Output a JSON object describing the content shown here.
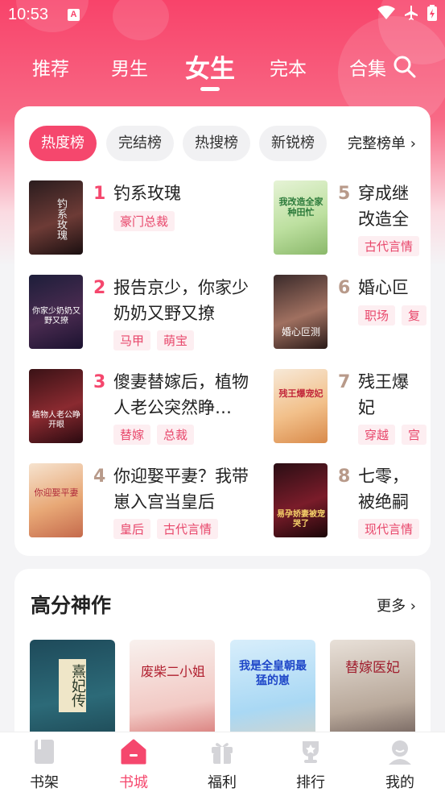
{
  "status_bar": {
    "time": "10:53",
    "badge": "A"
  },
  "top_tabs": [
    {
      "label": "推荐"
    },
    {
      "label": "男生"
    },
    {
      "label": "女生",
      "active": true
    },
    {
      "label": "完本"
    },
    {
      "label": "合集"
    }
  ],
  "rank": {
    "chips": [
      {
        "label": "热度榜",
        "active": true
      },
      {
        "label": "完结榜"
      },
      {
        "label": "热搜榜"
      },
      {
        "label": "新锐榜"
      }
    ],
    "full_list_label": "完整榜单",
    "items": [
      {
        "num": "1",
        "title": "钓系玫瑰",
        "tags": [
          "豪门总裁"
        ]
      },
      {
        "num": "2",
        "title": "报告京少，你家少奶奶又野又撩",
        "tags": [
          "马甲",
          "萌宝"
        ]
      },
      {
        "num": "3",
        "title": "傻妻替嫁后，植物人老公突然睁…",
        "tags": [
          "替嫁",
          "总裁"
        ]
      },
      {
        "num": "4",
        "title": "你迎娶平妻？我带崽入宫当皇后",
        "tags": [
          "皇后",
          "古代言情"
        ]
      },
      {
        "num": "5",
        "title": "穿成继改造全",
        "tags": [
          "古代言情"
        ]
      },
      {
        "num": "6",
        "title": "婚心叵",
        "tags": [
          "职场",
          "复"
        ]
      },
      {
        "num": "7",
        "title": "残王爆妃",
        "tags": [
          "穿越",
          "宫"
        ]
      },
      {
        "num": "8",
        "title": "七零，被绝嗣",
        "tags": [
          "现代言情"
        ]
      }
    ],
    "cover_texts": [
      "钓系玫瑰",
      "你家少奶奶又野又撩",
      "植物人老公睁开眼",
      "你迎娶平妻",
      "我改造全家种田忙",
      "婚心叵测",
      "残王爆宠妃",
      "易孕娇妻被宠哭了"
    ]
  },
  "high_score": {
    "title": "高分神作",
    "more_label": "更多",
    "cover_texts": [
      "熹妃传",
      "废柴二小姐",
      "我是全皇朝最猛的崽",
      "替嫁医妃"
    ]
  },
  "bottom_nav": [
    {
      "label": "书架",
      "icon": "book-icon"
    },
    {
      "label": "书城",
      "icon": "home-icon",
      "active": true
    },
    {
      "label": "福利",
      "icon": "gift-icon"
    },
    {
      "label": "排行",
      "icon": "trophy-icon"
    },
    {
      "label": "我的",
      "icon": "user-icon"
    }
  ],
  "colors": {
    "accent": "#f5476d",
    "rank_top": "#f5476d",
    "rank_other": "#b89a8a",
    "tag_bg": "#fdeef1"
  }
}
